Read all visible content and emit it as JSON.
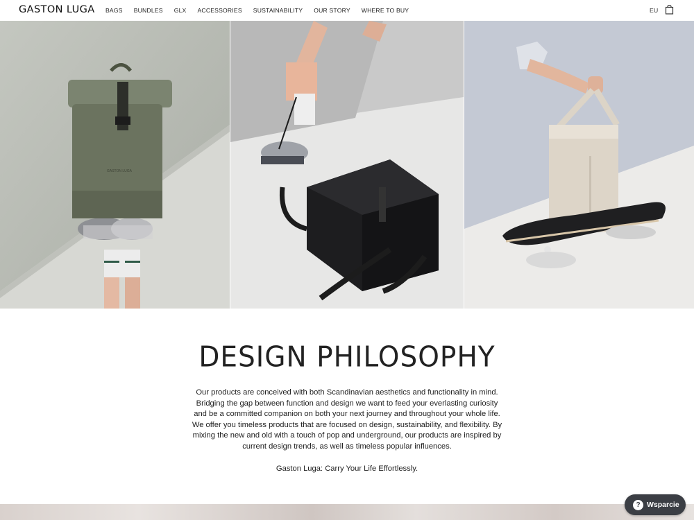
{
  "header": {
    "logo": "GASTON LUGA",
    "nav": [
      "BAGS",
      "BUNDLES",
      "GLX",
      "ACCESSORIES",
      "SUSTAINABILITY",
      "OUR STORY",
      "WHERE TO BUY"
    ],
    "region": "EU",
    "cart_icon": "shopping-bag-icon"
  },
  "hero": {
    "panels": [
      {
        "name": "olive-rolltop-backpack",
        "background": "#b8bcb5",
        "bag_color": "#6b735f",
        "bag_label": "GASTON LUGA"
      },
      {
        "name": "black-backpack",
        "background": "#d8d8d8",
        "bag_color": "#1d1d1f"
      },
      {
        "name": "beige-tote-skateboard",
        "background": "#c8ccd6",
        "bag_color": "#ddd5c8"
      }
    ]
  },
  "content": {
    "title": "DESIGN PHILOSOPHY",
    "body_lines": [
      "Our products are conceived with both Scandinavian aesthetics and functionality in mind.",
      "Bridging the gap between function and design we want to feed your everlasting curiosity",
      "and be a committed companion on both your next journey and throughout your whole life.",
      "We offer you timeless products that are focused on design, sustainability, and flexibility. By",
      "mixing the new and old with a touch of pop and underground, our products are inspired by",
      "current design trends, as well as timeless popular influences."
    ],
    "tagline": "Gaston Luga: Carry Your Life Effortlessly."
  },
  "support": {
    "label": "Wsparcie",
    "icon": "question-mark-icon",
    "icon_glyph": "?"
  }
}
